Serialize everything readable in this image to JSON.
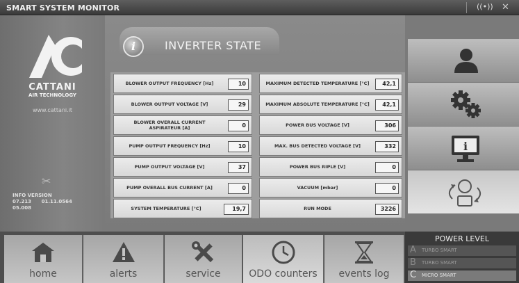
{
  "window": {
    "title": "SMART SYSTEM MONITOR"
  },
  "brand": {
    "name": "CATTANI",
    "tagline": "AIR TECHNOLOGY",
    "url": "www.cattani.it"
  },
  "info_version": {
    "label": "INFO VERSION",
    "line1": "07.213      01.11.0564",
    "line2": "05.008"
  },
  "panel": {
    "title": "INVERTER STATE"
  },
  "readings_left": [
    {
      "label": "BLOWER OUTPUT FREQUENCY [Hz]",
      "value": "10"
    },
    {
      "label": "BLOWER OUTPUT VOLTAGE [V]",
      "value": "29"
    },
    {
      "label": "BLOWER OVERALL CURRENT ASPIRATEUR [A]",
      "value": "0"
    },
    {
      "label": "PUMP OUTPUT FREQUENCY [Hz]",
      "value": "10"
    },
    {
      "label": "PUMP OUTPUT VOLTAGE [V]",
      "value": "37"
    },
    {
      "label": "PUMP OVERALL BUS CURRENT [A]",
      "value": "0"
    },
    {
      "label": "SYSTEM TEMPERATURE [°C]",
      "value": "19,7"
    }
  ],
  "readings_right": [
    {
      "label": "MAXIMUM DETECTED TEMPERATURE [°C]",
      "value": "42,1"
    },
    {
      "label": "MAXIMUM ABSOLUTE TEMPERATURE [°C]",
      "value": "42,1"
    },
    {
      "label": "POWER BUS VOLTAGE [V]",
      "value": "306"
    },
    {
      "label": "MAX. BUS DETECTED VOLTAGE [V]",
      "value": "332"
    },
    {
      "label": "POWER BUS RIPLE [V]",
      "value": "0"
    },
    {
      "label": "VACUUM [mbar]",
      "value": "0"
    },
    {
      "label": "RUN MODE",
      "value": "3226"
    }
  ],
  "side_buttons": [
    {
      "icon": "user-icon"
    },
    {
      "icon": "gears-icon"
    },
    {
      "icon": "monitor-info-icon"
    },
    {
      "icon": "sync-icon"
    }
  ],
  "nav": [
    {
      "label": "home",
      "icon": "home-icon"
    },
    {
      "label": "alerts",
      "icon": "alert-icon"
    },
    {
      "label": "service",
      "icon": "tools-icon"
    },
    {
      "label": "ODO counters",
      "icon": "clock-icon"
    },
    {
      "label": "events log",
      "icon": "hourglass-icon"
    }
  ],
  "power_level": {
    "title": "POWER LEVEL",
    "options": [
      {
        "letter": "A",
        "label": "TURBO SMART",
        "selected": false
      },
      {
        "letter": "B",
        "label": "TURBO SMART",
        "selected": false
      },
      {
        "letter": "C",
        "label": "MICRO SMART",
        "selected": true
      }
    ]
  }
}
